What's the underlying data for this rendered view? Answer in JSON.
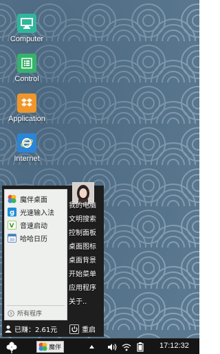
{
  "desktop": {
    "icons": [
      {
        "label": "Computer",
        "icon": "computer-icon",
        "color": "#2fb79b"
      },
      {
        "label": "Control",
        "icon": "control-list-icon",
        "color": "#36b36a"
      },
      {
        "label": "Application",
        "icon": "dropbox-box-icon",
        "color": "#f0962a"
      },
      {
        "label": "Internet",
        "icon": "internet-explorer-icon",
        "color": "#2a86d9"
      }
    ]
  },
  "start_menu": {
    "apps": [
      {
        "label": "魔伴桌面",
        "icon": "pinwheel-icon"
      },
      {
        "label": "光速输入法",
        "icon": "g-keyboard-icon"
      },
      {
        "label": "音速启动",
        "icon": "v-launcher-icon"
      },
      {
        "label": "哈哈日历",
        "icon": "calendar-icon"
      }
    ],
    "all_programs": "所有程序",
    "links": [
      "我的电脑",
      "文明搜索",
      "控制面板",
      "桌面图标",
      "桌面背景",
      "开始菜单",
      "应用程序",
      "关于.."
    ],
    "earned": "已赚：2.61元",
    "restart": "重启"
  },
  "taskbar": {
    "task_label": "魔伴",
    "clock": "17:12:32"
  }
}
